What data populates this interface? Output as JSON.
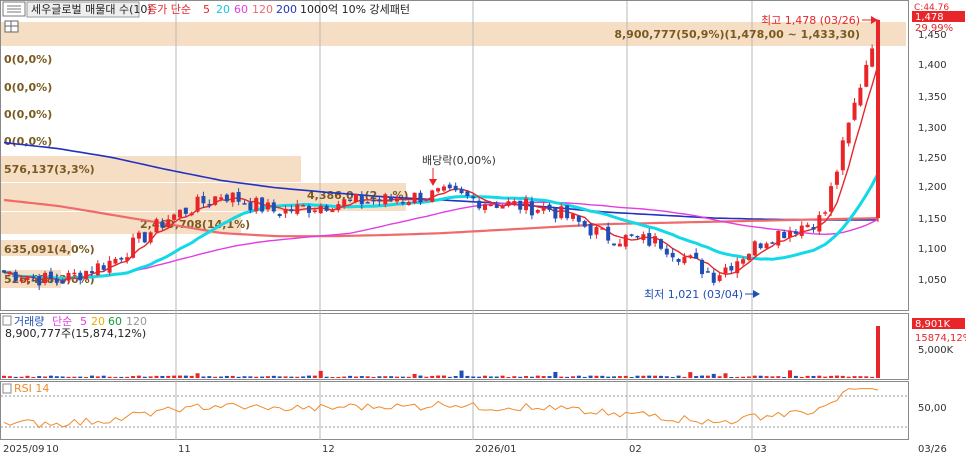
{
  "header": {
    "symbol_label": "세우글로벌 매물대 수(10)",
    "ma_prefix": "종가 단순",
    "ma_periods": [
      "5",
      "20",
      "60",
      "120",
      "200"
    ],
    "condition_label": "1000억 10% 강세패턴"
  },
  "price_axis": {
    "ticks": [
      "1,450",
      "1,400",
      "1,350",
      "1,300",
      "1,250",
      "1,200",
      "1,150",
      "1,100",
      "1,050"
    ],
    "badge_top": "C:44.76",
    "badge_price": "1,478",
    "badge_pct": "29.99%"
  },
  "annotations": {
    "high": "최고 1,478 (03/26)",
    "low": "최저 1,021 (03/04)",
    "dividend": "배당락(0,00%)",
    "top_band": "8,900,777(50,9%)(1,478,00 ~ 1,433,30)",
    "band_labels": [
      "0(0,0%)",
      "0(0,0%)",
      "0(0,0%)",
      "0(0,0%)",
      "576,137(3,3%)",
      "4,386,0__(2_,_%)",
      "2,469,708(14,1%)",
      "635,091(4,0%)",
      "526,418(3,0%)"
    ]
  },
  "volume_panel": {
    "title": "거래량",
    "ma_prefix": "단순",
    "ma_periods": [
      "5",
      "20",
      "60",
      "120"
    ],
    "last_value": "8,900,777주(15,874,12%)",
    "ticks": [
      "5,000K"
    ],
    "badge_value": "8,901K",
    "badge_pct": "15874,12%"
  },
  "rsi_panel": {
    "title": "RSI 14",
    "ticks": [
      "50,00"
    ]
  },
  "x_axis": {
    "labels": [
      "2025/09",
      "10",
      "11",
      "12",
      "2026/01",
      "02",
      "03"
    ],
    "cursor_date": "03/26"
  },
  "colors": {
    "up": "#e8262a",
    "down": "#1f4fb4",
    "ma5": "#e8262a",
    "ma20": "#12d8e8",
    "ma60": "#e23ee0",
    "ma120": "#f06a6a",
    "ma200": "#2233c0",
    "band_fill": "#f5dec4",
    "rsi": "#f08a2a"
  },
  "chart_data": {
    "type": "candlestick",
    "x": [
      "2025-09-25",
      "2025-10-01",
      "2025-10-10",
      "2025-10-20",
      "2025-11-03",
      "2025-11-17",
      "2025-12-01",
      "2025-12-15",
      "2026-01-02",
      "2026-01-16",
      "2026-02-02",
      "2026-02-16",
      "2026-03-03",
      "2026-03-10",
      "2026-03-18",
      "2026-03-25",
      "2026-03-26"
    ],
    "close": [
      1060,
      1045,
      1080,
      1150,
      1190,
      1160,
      1175,
      1180,
      1190,
      1175,
      1165,
      1120,
      1110,
      1055,
      1120,
      1150,
      1478
    ],
    "ma120_approx": [
      1180,
      1170,
      1155,
      1140,
      1125,
      1120,
      1120,
      1122,
      1125,
      1130,
      1135,
      1140,
      1142,
      1144,
      1146,
      1148,
      1150
    ],
    "ma200_approx": [
      1275,
      1265,
      1250,
      1230,
      1212,
      1200,
      1192,
      1185,
      1180,
      1175,
      1168,
      1160,
      1155,
      1150,
      1148,
      1147,
      1147
    ],
    "ylim": [
      1005,
      1490
    ],
    "y_ticks": [
      1050,
      1100,
      1150,
      1200,
      1250,
      1300,
      1350,
      1400,
      1450
    ],
    "high": {
      "value": 1478,
      "date": "03/26"
    },
    "low": {
      "value": 1021,
      "date": "03/04"
    },
    "last_volume": 8900777,
    "rsi_reference": 50
  }
}
